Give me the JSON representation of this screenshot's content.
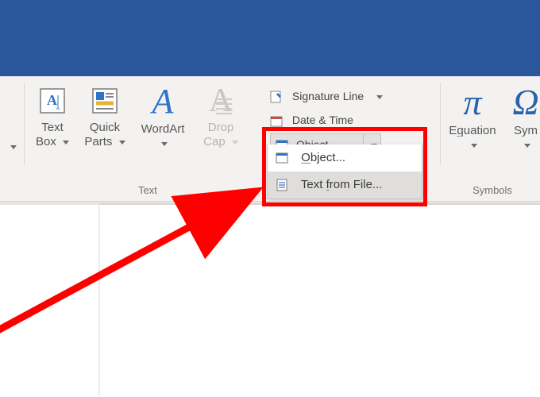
{
  "ribbon": {
    "text_box": {
      "label": "Text",
      "label2": "Box"
    },
    "quick_parts": {
      "label": "Quick",
      "label2": "Parts"
    },
    "wordart": {
      "label": "WordArt"
    },
    "dropcap": {
      "label": "Drop",
      "label2": "Cap"
    },
    "signature_line": "Signature Line",
    "date_time": "Date & Time",
    "object_button": "Object",
    "group_text": "Text",
    "equation": "Equation",
    "symbol": "Symbol",
    "group_symbols": "Symbols"
  },
  "menu": {
    "object": "Object...",
    "text_from_file": "Text from File..."
  },
  "colors": {
    "highlight_border": "#ff0000",
    "titlebar": "#2a579b"
  }
}
